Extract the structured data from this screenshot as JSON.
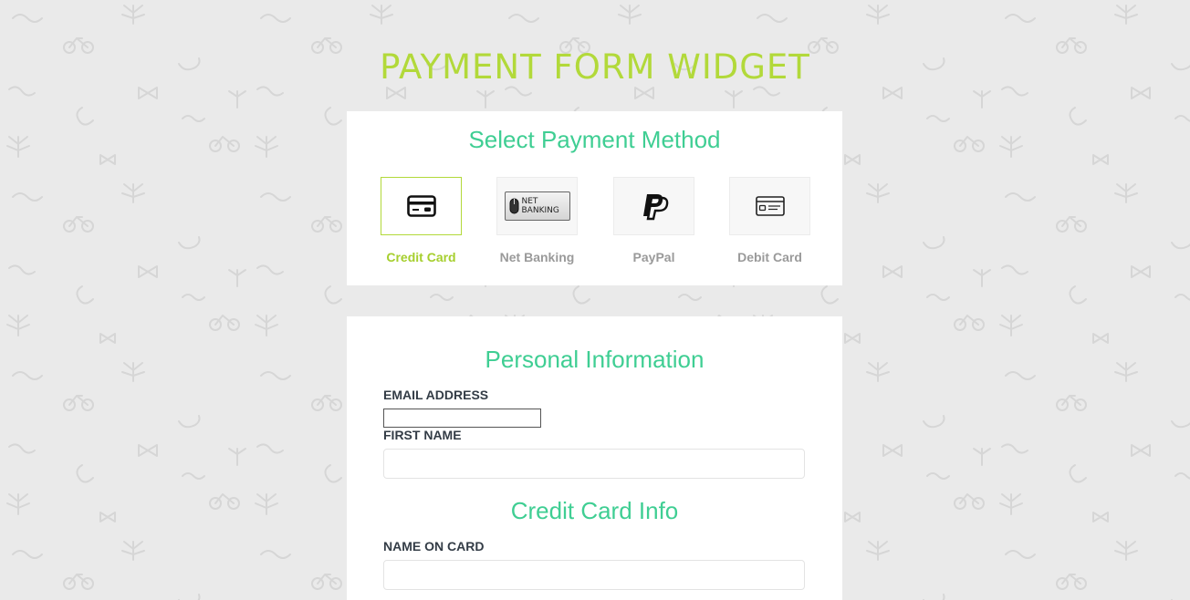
{
  "page": {
    "title": "PAYMENT FORM WIDGET"
  },
  "methods": {
    "heading": "Select Payment Method",
    "selected": "Credit Card",
    "items": [
      {
        "label": "Credit Card",
        "icon": "credit-card-icon",
        "active": true
      },
      {
        "label": "Net Banking",
        "icon": "net-banking-icon",
        "badge_lines": [
          "NET",
          "BANKING"
        ],
        "active": false
      },
      {
        "label": "PayPal",
        "icon": "paypal-icon",
        "active": false
      },
      {
        "label": "Debit Card",
        "icon": "debit-card-icon",
        "active": false
      }
    ]
  },
  "personal": {
    "heading": "Personal Information",
    "email_label": "EMAIL ADDRESS",
    "email_value": "",
    "first_name_label": "FIRST NAME",
    "first_name_value": ""
  },
  "card": {
    "heading": "Credit Card Info",
    "name_label": "NAME ON CARD",
    "name_value": ""
  },
  "colors": {
    "title": "#b2d93a",
    "heading": "#3fce93",
    "active": "#a6cf2e",
    "background": "#eaeaea"
  }
}
